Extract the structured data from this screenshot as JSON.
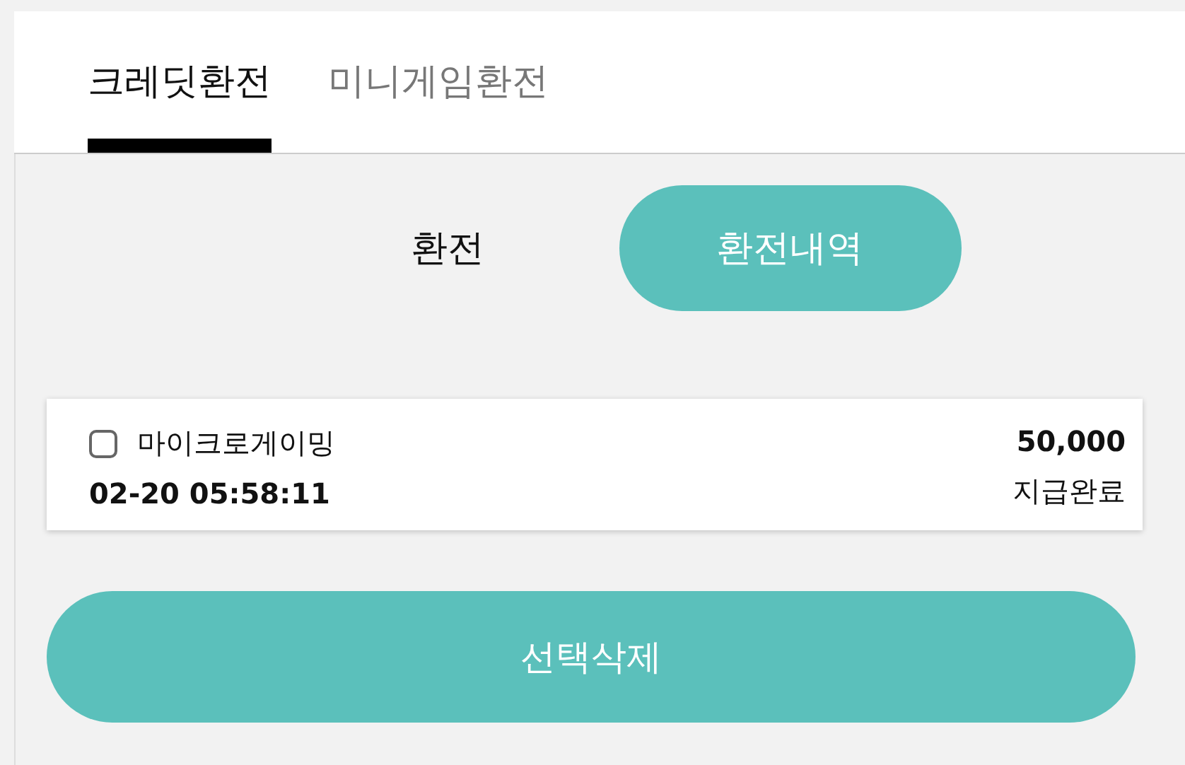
{
  "tabs": [
    {
      "label": "크레딧환전",
      "selected": true
    },
    {
      "label": "미니게임환전",
      "selected": false
    }
  ],
  "segments": [
    {
      "label": "환전",
      "selected": false
    },
    {
      "label": "환전내역",
      "selected": true
    }
  ],
  "records": [
    {
      "checked": false,
      "name": "마이크로게이밍",
      "amount": "50,000",
      "time": "02-20 05:58:11",
      "status": "지급완료"
    }
  ],
  "delete_button": "선택삭제"
}
